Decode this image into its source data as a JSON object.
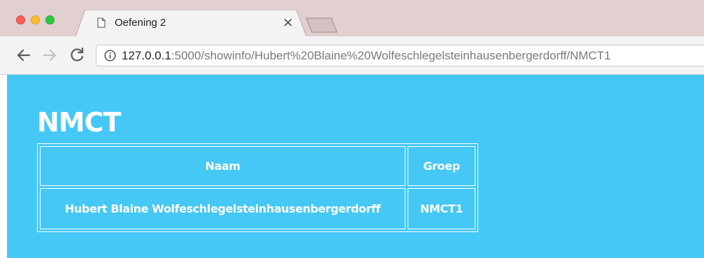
{
  "window": {
    "controls": [
      "close",
      "minimize",
      "maximize"
    ]
  },
  "tab": {
    "title": "Oefening 2",
    "close_glyph": "×",
    "favicon_icon": "document-icon"
  },
  "toolbar": {
    "back_icon": "arrow-left-icon",
    "forward_icon": "arrow-right-icon",
    "reload_icon": "reload-icon",
    "site_info_icon": "info-circle-icon",
    "url_host": "127.0.0.1",
    "url_rest": ":5000/showinfo/Hubert%20Blaine%20Wolfeschlegelsteinhausenbergerdorff/NMCT1"
  },
  "page": {
    "heading": "NMCT",
    "background_color": "#45c8f5",
    "table": {
      "headers": [
        "Naam",
        "Groep"
      ],
      "rows": [
        [
          "Hubert Blaine Wolfeschlegelsteinhausenbergerdorff",
          "NMCT1"
        ]
      ]
    }
  }
}
